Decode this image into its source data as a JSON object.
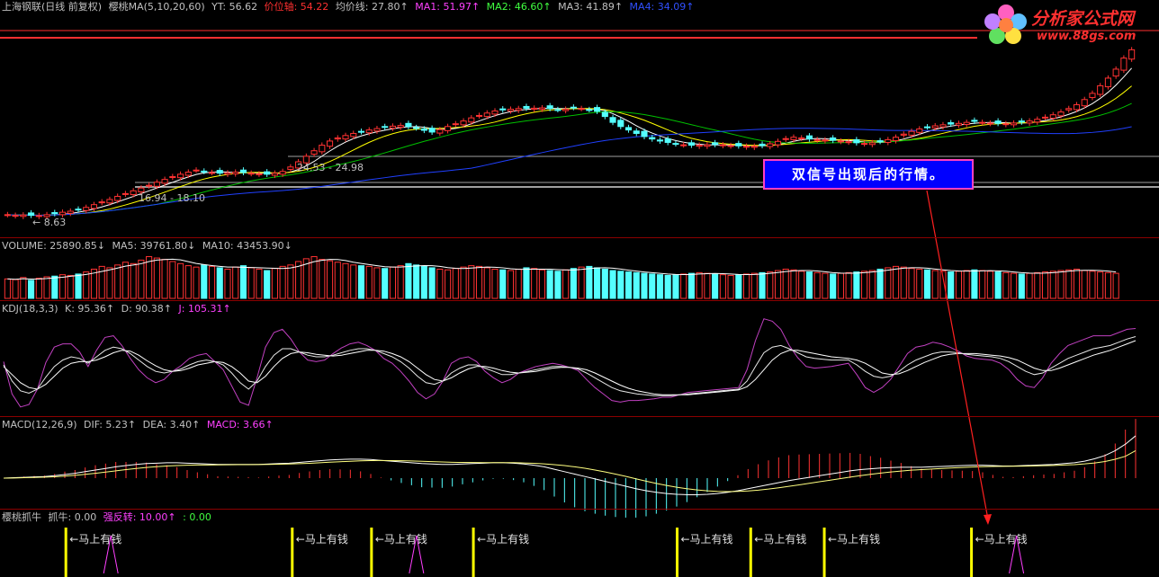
{
  "header": {
    "stock": "上海钢联(日线 前复权)",
    "ma_name": "樱桃MA(5,10,20,60)",
    "yt": "YT: 56.62",
    "price_axis": "价位轴: 54.22",
    "avg_line": "均价线: 27.80↑",
    "ma1": "MA1: 51.97↑",
    "ma2": "MA2: 46.60↑",
    "ma3": "MA3: 41.89↑",
    "ma4": "MA4: 34.09↑"
  },
  "price_labels": {
    "range1": "24.53 - 24.98",
    "range2": "16.94 - 18.10",
    "low": "← 8.63"
  },
  "volume": {
    "label": "VOLUME: 25890.85↓",
    "ma5": "MA5: 39761.80↓",
    "ma10": "MA10: 43453.90↓"
  },
  "kdj": {
    "label": "KDJ(18,3,3)",
    "k": "K: 95.36↑",
    "d": "D: 90.38↑",
    "j": "J: 105.31↑"
  },
  "macd": {
    "label": "MACD(12,26,9)",
    "dif": "DIF: 5.23↑",
    "dea": "DEA: 3.40↑",
    "macd": "MACD: 3.66↑"
  },
  "signal": {
    "label": "樱桃抓牛",
    "zhuaniu": "抓牛: 0.00",
    "qiangfan": "强反转: 10.00↑",
    "extra": ": 0.00",
    "marker_text": "←马上有钱"
  },
  "annotation": "双信号出现后的行情。",
  "logo": {
    "title": "分析家公式网",
    "url": "www.88gs.com"
  },
  "colors": {
    "up": "#ff3232",
    "down": "#54ffff",
    "ma1": "#ffffff",
    "ma2": "#ffff00",
    "ma3": "#00c000",
    "ma4": "#2040ff",
    "kdj_j": "#c040c0",
    "signal": "#ffff00"
  },
  "chart_data": {
    "type": "candlestick",
    "close": [
      8.9,
      8.7,
      8.8,
      8.7,
      8.63,
      8.9,
      9.2,
      9.6,
      9.9,
      10.4,
      11.0,
      11.8,
      12.6,
      13.3,
      14.2,
      15.0,
      15.8,
      16.6,
      17.4,
      18.3,
      19.1,
      19.9,
      20.6,
      21.2,
      21.8,
      21.4,
      21.1,
      20.9,
      21.0,
      21.2,
      21.1,
      20.9,
      20.7,
      20.6,
      20.9,
      21.4,
      22.7,
      24.2,
      25.8,
      27.4,
      29.0,
      30.2,
      31.1,
      31.8,
      32.4,
      32.9,
      33.4,
      33.8,
      34.2,
      34.5,
      34.7,
      34.4,
      34.0,
      33.3,
      32.8,
      33.5,
      34.4,
      35.2,
      36.0,
      36.9,
      37.6,
      38.3,
      38.9,
      39.2,
      39.4,
      39.6,
      39.7,
      39.7,
      39.8,
      39.6,
      39.3,
      39.4,
      39.9,
      39.6,
      39.3,
      38.8,
      37.3,
      35.6,
      34.4,
      33.4,
      32.4,
      31.5,
      30.8,
      30.2,
      29.8,
      29.4,
      29.1,
      29.0,
      29.0,
      29.1,
      29.2,
      29.1,
      28.9,
      28.8,
      28.7,
      28.7,
      28.9,
      29.4,
      30.1,
      30.9,
      31.3,
      31.1,
      30.8,
      30.6,
      30.5,
      30.4,
      30.2,
      30.0,
      29.7,
      29.5,
      29.7,
      30.1,
      30.6,
      31.3,
      32.2,
      33.0,
      33.7,
      34.3,
      34.6,
      34.9,
      35.1,
      35.3,
      35.6,
      35.9,
      35.6,
      35.4,
      35.3,
      35.2,
      35.4,
      35.7,
      36.0,
      36.5,
      37.1,
      37.8,
      38.6,
      39.6,
      40.7,
      42.2,
      44.0,
      46.2,
      48.4,
      51.0,
      54.2,
      56.6
    ],
    "volume": [
      28,
      27,
      30,
      26,
      29,
      31,
      32,
      34,
      33,
      35,
      38,
      42,
      46,
      44,
      48,
      52,
      50,
      55,
      60,
      58,
      56,
      53,
      50,
      47,
      45,
      48,
      46,
      44,
      42,
      45,
      47,
      44,
      42,
      40,
      43,
      46,
      48,
      53,
      57,
      60,
      56,
      54,
      52,
      50,
      48,
      47,
      46,
      44,
      43,
      45,
      47,
      50,
      48,
      46,
      44,
      42,
      41,
      43,
      45,
      47,
      46,
      44,
      42,
      41,
      40,
      42,
      44,
      43,
      41,
      40,
      39,
      41,
      43,
      45,
      46,
      44,
      42,
      40,
      39,
      38,
      37,
      36,
      35,
      34,
      33,
      34,
      35,
      36,
      37,
      36,
      35,
      34,
      33,
      34,
      35,
      36,
      37,
      38,
      40,
      42,
      41,
      39,
      38,
      37,
      36,
      35,
      36,
      37,
      38,
      39,
      40,
      42,
      44,
      46,
      45,
      43,
      42,
      41,
      40,
      39,
      38,
      39,
      40,
      41,
      40,
      39,
      38,
      37,
      36,
      35,
      36,
      37,
      38,
      39,
      40,
      41,
      42,
      40,
      39,
      38,
      37,
      36
    ],
    "kdj": {
      "k": [
        60,
        40,
        28,
        25,
        30,
        45,
        58,
        66,
        70,
        68,
        62,
        70,
        78,
        82,
        80,
        74,
        66,
        58,
        52,
        50,
        52,
        55,
        60,
        64,
        66,
        64,
        60,
        50,
        38,
        30,
        40,
        58,
        72,
        80,
        80,
        76,
        72,
        70,
        70,
        72,
        75,
        78,
        80,
        80,
        78,
        74,
        70,
        64,
        56,
        46,
        38,
        36,
        40,
        50,
        56,
        60,
        60,
        56,
        52,
        48,
        48,
        50,
        52,
        54,
        56,
        58,
        58,
        57,
        55,
        50,
        44,
        38,
        32,
        28,
        26,
        24,
        23,
        22,
        22,
        22,
        23,
        24,
        25,
        26,
        27,
        28,
        29,
        30,
        40,
        58,
        75,
        82,
        84,
        80,
        75,
        70,
        68,
        67,
        66,
        66,
        66,
        60,
        52,
        46,
        44,
        46,
        52,
        60,
        66,
        70,
        74,
        76,
        76,
        75,
        73,
        72,
        71,
        70,
        68,
        64,
        58,
        52,
        48,
        50,
        56,
        62,
        68,
        72,
        76,
        80,
        82,
        84,
        88,
        92,
        95
      ],
      "d": [
        58,
        48,
        38,
        32,
        30,
        36,
        46,
        56,
        62,
        64,
        64,
        66,
        70,
        75,
        78,
        77,
        72,
        65,
        59,
        54,
        52,
        53,
        56,
        60,
        62,
        64,
        63,
        58,
        50,
        40,
        38,
        46,
        58,
        68,
        74,
        76,
        75,
        73,
        72,
        71,
        72,
        74,
        76,
        78,
        78,
        77,
        74,
        70,
        64,
        56,
        48,
        42,
        40,
        44,
        50,
        55,
        58,
        58,
        56,
        53,
        51,
        50,
        51,
        52,
        54,
        56,
        57,
        57,
        56,
        54,
        50,
        45,
        40,
        35,
        31,
        28,
        26,
        24,
        23,
        23,
        23,
        23,
        24,
        25,
        26,
        27,
        28,
        29,
        33,
        42,
        54,
        66,
        74,
        78,
        78,
        76,
        74,
        72,
        70,
        69,
        68,
        66,
        62,
        56,
        50,
        48,
        49,
        53,
        58,
        63,
        67,
        71,
        73,
        74,
        74,
        74,
        73,
        72,
        71,
        69,
        66,
        61,
        56,
        53,
        53,
        56,
        60,
        64,
        68,
        72,
        75,
        78,
        82,
        86,
        90
      ],
      "j": [
        64,
        24,
        8,
        11,
        30,
        63,
        82,
        86,
        86,
        76,
        58,
        78,
        94,
        96,
        84,
        68,
        54,
        44,
        38,
        42,
        52,
        59,
        68,
        72,
        74,
        64,
        54,
        34,
        14,
        10,
        44,
        82,
        100,
        104,
        92,
        76,
        66,
        64,
        66,
        74,
        81,
        86,
        88,
        84,
        78,
        68,
        62,
        52,
        40,
        26,
        18,
        24,
        40,
        62,
        68,
        70,
        64,
        52,
        44,
        38,
        42,
        50,
        54,
        58,
        60,
        62,
        60,
        57,
        53,
        42,
        32,
        24,
        16,
        14,
        16,
        16,
        17,
        18,
        20,
        20,
        23,
        26,
        27,
        28,
        29,
        30,
        31,
        32,
        54,
        90,
        117,
        114,
        104,
        84,
        69,
        58,
        56,
        57,
        58,
        60,
        62,
        48,
        32,
        26,
        32,
        42,
        58,
        74,
        82,
        84,
        88,
        86,
        82,
        77,
        71,
        68,
        67,
        66,
        62,
        54,
        42,
        34,
        32,
        44,
        62,
        74,
        84,
        88,
        92,
        96,
        96,
        96,
        100,
        104,
        105
      ]
    },
    "macd": {
      "dif": [
        0.0,
        0.05,
        0.1,
        0.15,
        0.2,
        0.3,
        0.45,
        0.6,
        0.8,
        1.0,
        1.2,
        1.4,
        1.55,
        1.7,
        1.8,
        1.85,
        1.9,
        1.9,
        1.85,
        1.8,
        1.75,
        1.7,
        1.7,
        1.7,
        1.7,
        1.7,
        1.75,
        1.8,
        1.85,
        1.95,
        2.05,
        2.15,
        2.25,
        2.3,
        2.35,
        2.35,
        2.3,
        2.2,
        2.1,
        2.0,
        1.9,
        1.8,
        1.75,
        1.7,
        1.7,
        1.75,
        1.8,
        1.85,
        1.9,
        1.9,
        1.85,
        1.75,
        1.6,
        1.4,
        1.1,
        0.8,
        0.5,
        0.2,
        -0.1,
        -0.4,
        -0.7,
        -1.0,
        -1.3,
        -1.55,
        -1.75,
        -1.9,
        -2.0,
        -2.05,
        -2.05,
        -2.0,
        -1.9,
        -1.75,
        -1.55,
        -1.3,
        -1.05,
        -0.8,
        -0.55,
        -0.3,
        -0.1,
        0.1,
        0.3,
        0.5,
        0.7,
        0.9,
        1.05,
        1.15,
        1.25,
        1.3,
        1.35,
        1.35,
        1.35,
        1.4,
        1.45,
        1.5,
        1.55,
        1.6,
        1.6,
        1.55,
        1.5,
        1.5,
        1.55,
        1.6,
        1.65,
        1.7,
        1.8,
        1.9,
        2.1,
        2.4,
        2.8,
        3.4,
        4.2,
        5.23
      ],
      "dea": [
        0.0,
        0.02,
        0.05,
        0.08,
        0.12,
        0.17,
        0.25,
        0.35,
        0.47,
        0.6,
        0.75,
        0.9,
        1.05,
        1.2,
        1.32,
        1.42,
        1.5,
        1.56,
        1.6,
        1.62,
        1.63,
        1.64,
        1.65,
        1.66,
        1.67,
        1.68,
        1.7,
        1.72,
        1.75,
        1.79,
        1.84,
        1.9,
        1.97,
        2.03,
        2.09,
        2.14,
        2.17,
        2.18,
        2.17,
        2.15,
        2.12,
        2.08,
        2.04,
        2.0,
        1.96,
        1.94,
        1.93,
        1.92,
        1.92,
        1.92,
        1.91,
        1.88,
        1.84,
        1.77,
        1.67,
        1.55,
        1.4,
        1.22,
        1.0,
        0.76,
        0.5,
        0.22,
        -0.08,
        -0.37,
        -0.65,
        -0.9,
        -1.12,
        -1.31,
        -1.46,
        -1.57,
        -1.64,
        -1.66,
        -1.64,
        -1.58,
        -1.48,
        -1.35,
        -1.19,
        -1.01,
        -0.83,
        -0.64,
        -0.45,
        -0.26,
        -0.07,
        0.12,
        0.3,
        0.47,
        0.62,
        0.76,
        0.88,
        0.98,
        1.06,
        1.13,
        1.2,
        1.26,
        1.32,
        1.38,
        1.42,
        1.45,
        1.46,
        1.47,
        1.49,
        1.51,
        1.54,
        1.57,
        1.62,
        1.67,
        1.76,
        1.88,
        2.06,
        2.33,
        2.7,
        3.4
      ]
    },
    "signal_positions": [
      0.055,
      0.255,
      0.325,
      0.415,
      0.595,
      0.66,
      0.725,
      0.855
    ]
  }
}
